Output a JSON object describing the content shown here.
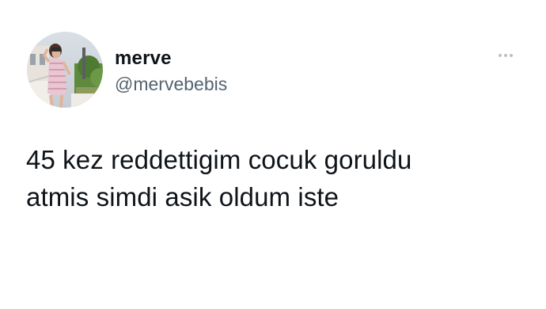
{
  "user": {
    "display_name": "merve",
    "handle": "@mervebebis",
    "avatar_icon": "profile-photo"
  },
  "menu": {
    "icon": "more-horizontal-icon"
  },
  "tweet": {
    "lines": [
      "45 kez reddettigim cocuk goruldu",
      "atmis simdi asik oldum iste"
    ]
  },
  "colors": {
    "background": "#ffffff",
    "name_text": "#0f1419",
    "handle_text": "#536471",
    "more_dots": "#b9c0c6"
  }
}
